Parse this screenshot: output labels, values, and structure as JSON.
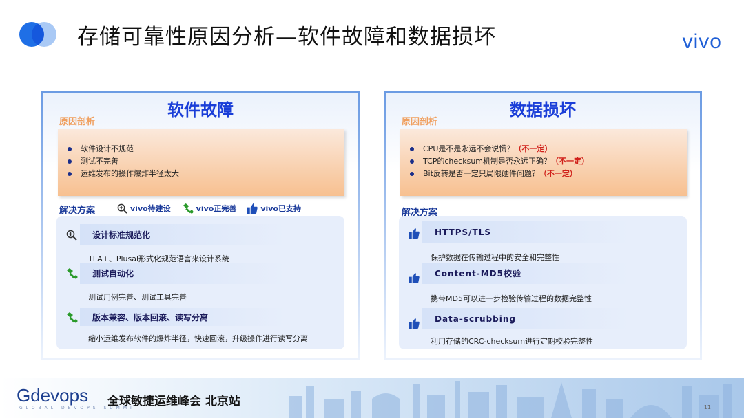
{
  "header": {
    "title": "存储可靠性原因分析—软件故障和数据损坏",
    "brand": "vivo",
    "accent_color": "#1f6fe6"
  },
  "left_panel": {
    "title": "软件故障",
    "cause_label": "原因剖析",
    "causes": [
      "软件设计不规范",
      "测试不完善",
      "运维发布的操作爆炸半径太大"
    ],
    "solution_label": "解决方案",
    "legend": [
      {
        "icon": "magnifier-plus-icon",
        "label": "vivo待建设"
      },
      {
        "icon": "wrench-icon",
        "label": "vivo正完善"
      },
      {
        "icon": "thumbs-up-icon",
        "label": "vivo已支持"
      }
    ],
    "solutions": [
      {
        "icon": "magnifier-plus-icon",
        "title": "设计标准规范化",
        "desc": "TLA+、Plusal形式化规范语言来设计系统"
      },
      {
        "icon": "wrench-icon",
        "title": "测试自动化",
        "desc": "测试用例完善、测试工具完善"
      },
      {
        "icon": "wrench-icon",
        "title": "版本兼容、版本回滚、读写分离",
        "desc": "缩小运维发布软件的爆炸半径，快速回滚，升级操作进行读写分离"
      }
    ]
  },
  "right_panel": {
    "title": "数据损坏",
    "cause_label": "原因剖析",
    "causes": [
      {
        "text": "CPU是不是永远不会说慌？",
        "tag": "（不一定）"
      },
      {
        "text": "TCP的checksum机制是否永远正确？",
        "tag": "（不一定）"
      },
      {
        "text": "Bit反转是否一定只局限硬件问题？",
        "tag": "（不一定）"
      }
    ],
    "solution_label": "解决方案",
    "solutions": [
      {
        "icon": "thumbs-up-icon",
        "title": "HTTPS/TLS",
        "desc": "保护数据在传输过程中的安全和完整性"
      },
      {
        "icon": "thumbs-up-icon",
        "title": "Content-MD5校验",
        "desc": "携带MD5可以进一步检验传输过程的数据完整性"
      },
      {
        "icon": "thumbs-up-icon",
        "title": "Data-scrubbing",
        "desc": "利用存储的CRC-checksum进行定期校验完整性"
      }
    ]
  },
  "footer": {
    "logo": "Gdevops",
    "event": "全球敏捷运维峰会 北京站",
    "sub": "GLOBAL DEVOPS SUMMIT",
    "page_number": "11"
  }
}
